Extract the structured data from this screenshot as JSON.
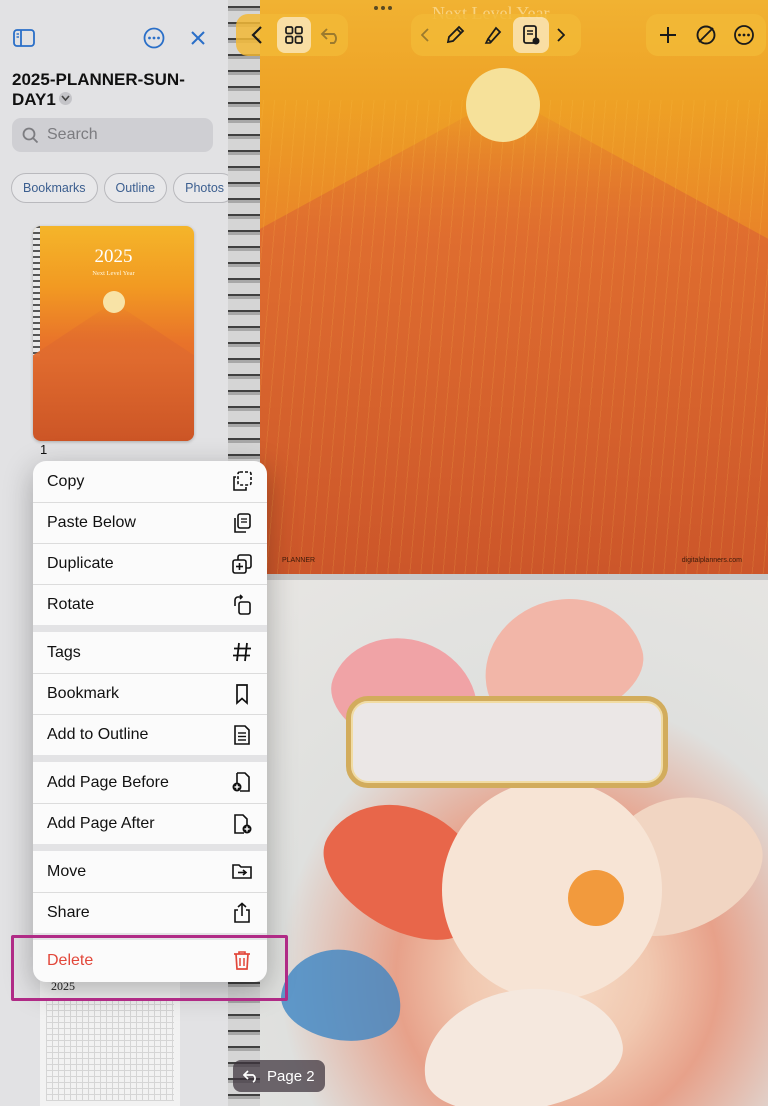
{
  "sidebar": {
    "title": "2025-PLANNER-SUN-DAY1",
    "search_placeholder": "Search",
    "chips": [
      "Bookmarks",
      "Outline",
      "Photos"
    ],
    "thumbnail": {
      "year": "2025",
      "subtitle": "Next Level Year",
      "page_number": "1"
    },
    "second_thumbnail": {
      "year": "2025"
    }
  },
  "toolbar": {
    "page_title": "Next Level Year",
    "groups": {
      "left": [
        "back-icon",
        "grid-icon",
        "undo-icon"
      ],
      "center": [
        "prev-icon",
        "pen-icon",
        "highlighter-icon",
        "notebook-edit-icon",
        "next-icon"
      ],
      "right": [
        "add-icon",
        "hide-tools-icon",
        "more-icon"
      ]
    }
  },
  "page1": {
    "footer_left": "PLANNER",
    "footer_right": "digitalplanners.com"
  },
  "page_indicator": {
    "label": "Page 2"
  },
  "menu": {
    "groups": [
      [
        {
          "label": "Copy",
          "icon": "copy-icon"
        },
        {
          "label": "Paste Below",
          "icon": "paste-icon"
        },
        {
          "label": "Duplicate",
          "icon": "duplicate-icon"
        },
        {
          "label": "Rotate",
          "icon": "rotate-icon"
        }
      ],
      [
        {
          "label": "Tags",
          "icon": "hashtag-icon"
        },
        {
          "label": "Bookmark",
          "icon": "bookmark-icon"
        },
        {
          "label": "Add to Outline",
          "icon": "outline-icon"
        }
      ],
      [
        {
          "label": "Add Page Before",
          "icon": "add-page-before-icon"
        },
        {
          "label": "Add Page After",
          "icon": "add-page-after-icon"
        }
      ],
      [
        {
          "label": "Move",
          "icon": "move-folder-icon"
        },
        {
          "label": "Share",
          "icon": "share-icon"
        }
      ],
      [
        {
          "label": "Delete",
          "icon": "trash-icon",
          "destructive": true
        }
      ]
    ]
  },
  "colors": {
    "accent": "#2a6fc8",
    "destructive": "#e2473a",
    "highlight": "#b02b86",
    "toolbar": "#f2b836"
  }
}
